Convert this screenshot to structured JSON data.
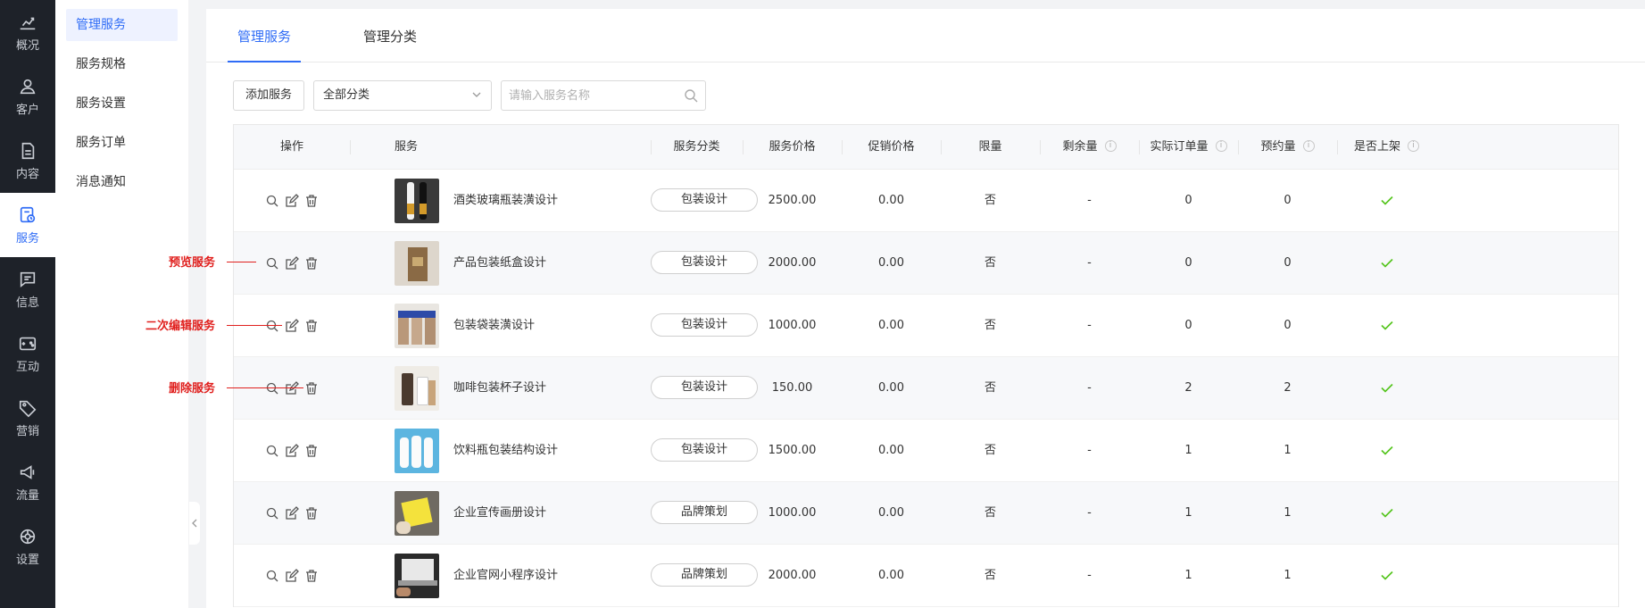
{
  "rail": [
    {
      "key": "overview",
      "label": "概况",
      "icon": "chart-icon"
    },
    {
      "key": "customer",
      "label": "客户",
      "icon": "user-icon"
    },
    {
      "key": "content",
      "label": "内容",
      "icon": "document-icon"
    },
    {
      "key": "service",
      "label": "服务",
      "icon": "service-icon",
      "active": true
    },
    {
      "key": "message",
      "label": "信息",
      "icon": "message-icon"
    },
    {
      "key": "interact",
      "label": "互动",
      "icon": "interact-icon"
    },
    {
      "key": "marketing",
      "label": "营销",
      "icon": "tag-icon"
    },
    {
      "key": "traffic",
      "label": "流量",
      "icon": "megaphone-icon"
    },
    {
      "key": "settings",
      "label": "设置",
      "icon": "gear-icon"
    }
  ],
  "submenu": [
    {
      "label": "管理服务",
      "active": true
    },
    {
      "label": "服务规格"
    },
    {
      "label": "服务设置"
    },
    {
      "label": "服务订单"
    },
    {
      "label": "消息通知"
    }
  ],
  "tabs": [
    {
      "label": "管理服务",
      "active": true
    },
    {
      "label": "管理分类"
    }
  ],
  "toolbar": {
    "add_label": "添加服务",
    "category_value": "全部分类",
    "search_placeholder": "请输入服务名称"
  },
  "table": {
    "headers": [
      "操作",
      "服务",
      "服务分类",
      "服务价格",
      "促销价格",
      "限量",
      "剩余量",
      "实际订单量",
      "预约量",
      "是否上架"
    ],
    "info_icon": "i",
    "rows": [
      {
        "name": "酒类玻璃瓶装潢设计",
        "category": "包装设计",
        "price": "2500.00",
        "promo": "0.00",
        "limited": "否",
        "remaining": "-",
        "orders": "0",
        "reservations": "0",
        "listed": true,
        "thumb": "bottles"
      },
      {
        "name": "产品包装纸盒设计",
        "category": "包装设计",
        "price": "2000.00",
        "promo": "0.00",
        "limited": "否",
        "remaining": "-",
        "orders": "0",
        "reservations": "0",
        "listed": true,
        "thumb": "box"
      },
      {
        "name": "包装袋装潢设计",
        "category": "包装设计",
        "price": "1000.00",
        "promo": "0.00",
        "limited": "否",
        "remaining": "-",
        "orders": "0",
        "reservations": "0",
        "listed": true,
        "thumb": "bags"
      },
      {
        "name": "咖啡包装杯子设计",
        "category": "包装设计",
        "price": "150.00",
        "promo": "0.00",
        "limited": "否",
        "remaining": "-",
        "orders": "2",
        "reservations": "2",
        "listed": true,
        "thumb": "cups"
      },
      {
        "name": "饮料瓶包装结构设计",
        "category": "包装设计",
        "price": "1500.00",
        "promo": "0.00",
        "limited": "否",
        "remaining": "-",
        "orders": "1",
        "reservations": "1",
        "listed": true,
        "thumb": "milk"
      },
      {
        "name": "企业宣传画册设计",
        "category": "品牌策划",
        "price": "1000.00",
        "promo": "0.00",
        "limited": "否",
        "remaining": "-",
        "orders": "1",
        "reservations": "1",
        "listed": true,
        "thumb": "brochure"
      },
      {
        "name": "企业官网小程序设计",
        "category": "品牌策划",
        "price": "2000.00",
        "promo": "0.00",
        "limited": "否",
        "remaining": "-",
        "orders": "1",
        "reservations": "1",
        "listed": true,
        "thumb": "laptop"
      }
    ]
  },
  "callouts": [
    {
      "label": "预览服务"
    },
    {
      "label": "二次编辑服务"
    },
    {
      "label": "删除服务"
    }
  ],
  "colors": {
    "accent": "#2f6cf6",
    "rail_bg": "#1e2229",
    "callout": "#e0201e",
    "check": "#52c41a"
  }
}
